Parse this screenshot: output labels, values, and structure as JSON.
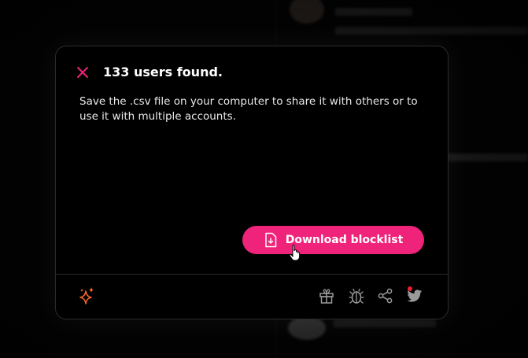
{
  "popup": {
    "title": "133 users found.",
    "description": "Save the .csv file on your computer to share it with others or to use it with multiple accounts.",
    "download_label": "Download blocklist",
    "accent_color": "#f0237a"
  },
  "icons": {
    "close": "close-icon",
    "file_download": "file-download-icon",
    "sparkle": "sparkle-icon",
    "gift": "gift-icon",
    "bug": "bug-icon",
    "share": "share-icon",
    "twitter": "twitter-icon"
  }
}
